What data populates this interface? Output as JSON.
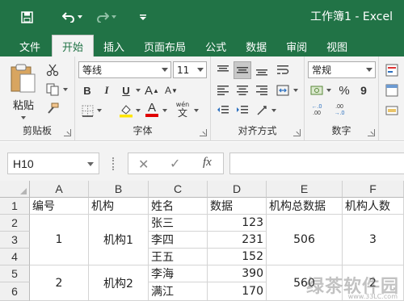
{
  "window": {
    "title": "工作簿1 - Excel"
  },
  "qat": {
    "save_icon": "save-icon",
    "undo_icon": "undo-icon",
    "redo_icon": "redo-icon",
    "customize_icon": "customize-qat-icon"
  },
  "tabs": [
    "文件",
    "开始",
    "插入",
    "页面布局",
    "公式",
    "数据",
    "审阅",
    "视图"
  ],
  "active_tab": "开始",
  "ribbon": {
    "clipboard": {
      "label": "剪贴板",
      "paste_label": "粘贴"
    },
    "font": {
      "label": "字体",
      "font_name": "等线",
      "font_size": "11",
      "bold": "B",
      "italic": "I",
      "underline": "U",
      "font_color_label": "A",
      "wen_label": "wén",
      "wen_char": "文",
      "grow_label": "A",
      "shrink_label": "A"
    },
    "alignment": {
      "label": "对齐方式"
    },
    "number": {
      "label": "数字",
      "format": "常规",
      "percent": "%",
      "comma": "9",
      "inc_decimal": ".00",
      "dec_decimal": ".0"
    }
  },
  "formula_bar": {
    "name_box": "H10",
    "cancel": "✕",
    "enter": "✓",
    "fx": "fx",
    "value": ""
  },
  "columns": [
    "A",
    "B",
    "C",
    "D",
    "E",
    "F"
  ],
  "rows": [
    "1",
    "2",
    "3",
    "4",
    "5",
    "6"
  ],
  "header_row": {
    "A": "编号",
    "B": "机构",
    "C": "姓名",
    "D": "数据",
    "E": "机构总数据",
    "F": "机构人数"
  },
  "group1": {
    "id": "1",
    "org": "机构1",
    "total": "506",
    "count": "3"
  },
  "group2": {
    "id": "2",
    "org": "机构2",
    "total": "560",
    "count": "2"
  },
  "people": [
    {
      "name": "张三",
      "value": "123"
    },
    {
      "name": "李四",
      "value": "231"
    },
    {
      "name": "王五",
      "value": "152"
    },
    {
      "name": "李海",
      "value": "390"
    },
    {
      "name": "满江",
      "value": "170"
    }
  ],
  "watermark": {
    "text": "绿茶软件园",
    "url": "www.33LC.com"
  }
}
